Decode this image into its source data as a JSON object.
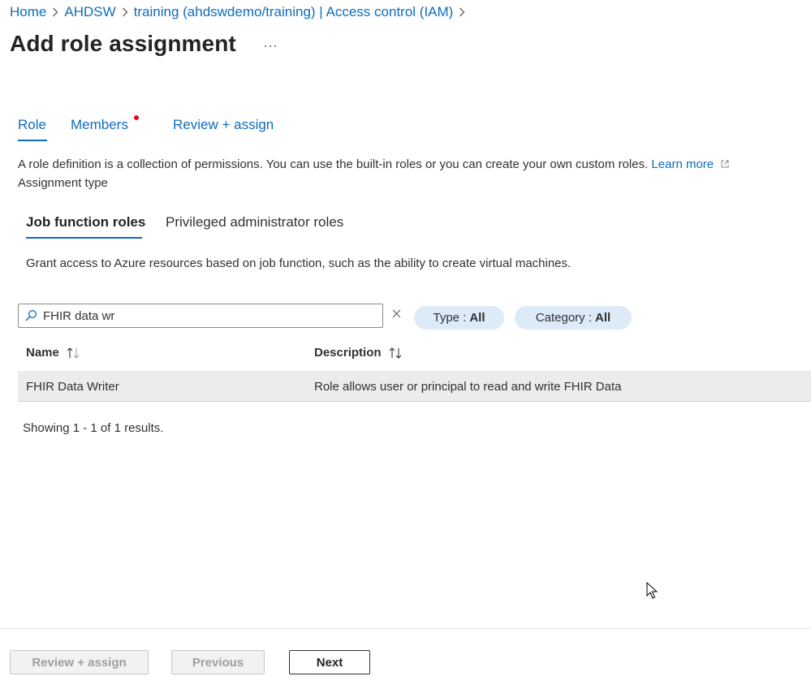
{
  "breadcrumb": {
    "items": [
      "Home",
      "AHDSW",
      "training (ahdswdemo/training) | Access control (IAM)"
    ]
  },
  "header": {
    "title": "Add role assignment",
    "more_label": "···"
  },
  "tabs": [
    {
      "label": "Role",
      "selected": true
    },
    {
      "label": "Members",
      "has_indicator": true
    },
    {
      "label": "Review + assign"
    }
  ],
  "description": {
    "text": "A role definition is a collection of permissions. You can use the built-in roles or you can create your own custom roles.",
    "learn_more": "Learn more",
    "assignment_type_label": "Assignment type"
  },
  "assignment_tabs": [
    {
      "label": "Job function roles",
      "selected": true
    },
    {
      "label": "Privileged administrator roles"
    }
  ],
  "grant_text": "Grant access to Azure resources based on job function, such as the ability to create virtual machines.",
  "search": {
    "value": "FHIR data wr"
  },
  "filters": {
    "type_label": "Type :",
    "type_value": "All",
    "category_label": "Category :",
    "category_value": "All"
  },
  "table": {
    "columns": [
      "Name",
      "Description"
    ],
    "rows": [
      {
        "name": "FHIR Data Writer",
        "description": "Role allows user or principal to read and write FHIR Data"
      }
    ]
  },
  "results_text": "Showing 1 - 1 of 1 results.",
  "footer": {
    "review_assign": "Review + assign",
    "previous": "Previous",
    "next": "Next"
  },
  "colors": {
    "accent": "#0f6cbd",
    "indicator": "#e00b1c",
    "pill_bg": "#ddeaf8",
    "row_selected_bg": "#ececec"
  },
  "icons": {
    "breadcrumb_separator": "chevron-right-icon",
    "more": "ellipsis-icon",
    "external_link": "external-link-icon",
    "search": "search-icon",
    "clear": "close-icon",
    "sort": "sort-arrows-icon"
  }
}
